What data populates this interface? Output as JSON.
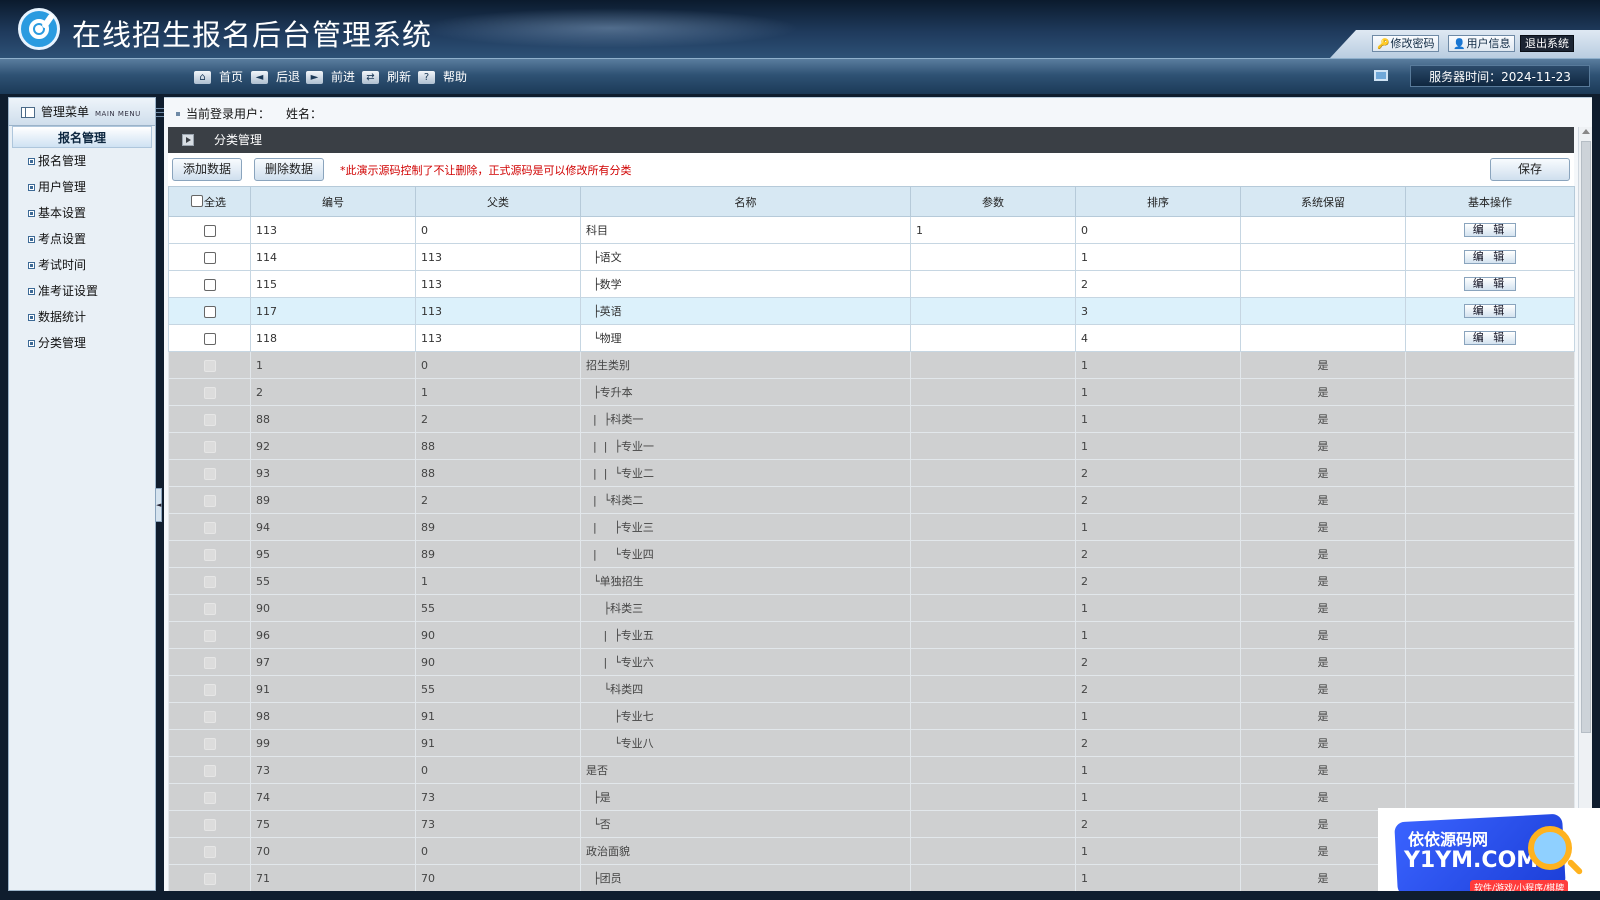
{
  "app": {
    "title": "在线招生报名后台管理系统"
  },
  "top_links": [
    "修改密码",
    "用户信息",
    "退出系统"
  ],
  "nav": [
    "首页",
    "后退",
    "前进",
    "刷新",
    "帮助"
  ],
  "server_time": "服务器时间：2024-11-23",
  "sidebar": {
    "title": "管理菜单",
    "subtitle": "MAIN MENU",
    "group": "报名管理",
    "items": [
      "报名管理",
      "用户管理",
      "基本设置",
      "考点设置",
      "考试时间",
      "准考证设置",
      "数据统计",
      "分类管理"
    ]
  },
  "user_bar": {
    "label": "当前登录用户：",
    "name_label": "姓名："
  },
  "panel_title": "分类管理",
  "toolbar": {
    "add": "添加数据",
    "delete": "删除数据",
    "notice": "*此演示源码控制了不让删除，正式源码是可以修改所有分类",
    "save": "保存"
  },
  "table": {
    "headers": [
      "全选",
      "编号",
      "父类",
      "名称",
      "参数",
      "排序",
      "系统保留",
      "基本操作"
    ],
    "edit_label": "编 辑",
    "rows": [
      {
        "id": "113",
        "parent": "0",
        "name": "科目",
        "param": "1",
        "sort": "0",
        "reserved": "",
        "editable": true
      },
      {
        "id": "114",
        "parent": "113",
        "name": "  ├语文",
        "param": "",
        "sort": "1",
        "reserved": "",
        "editable": true
      },
      {
        "id": "115",
        "parent": "113",
        "name": "  ├数学",
        "param": "",
        "sort": "2",
        "reserved": "",
        "editable": true
      },
      {
        "id": "117",
        "parent": "113",
        "name": "  ├英语",
        "param": "",
        "sort": "3",
        "reserved": "",
        "editable": true,
        "highlight": true
      },
      {
        "id": "118",
        "parent": "113",
        "name": "  └物理",
        "param": "",
        "sort": "4",
        "reserved": "",
        "editable": true
      },
      {
        "id": "1",
        "parent": "0",
        "name": "招生类别",
        "param": "",
        "sort": "1",
        "reserved": "是",
        "editable": false
      },
      {
        "id": "2",
        "parent": "1",
        "name": "  ├专升本",
        "param": "",
        "sort": "1",
        "reserved": "是",
        "editable": false
      },
      {
        "id": "88",
        "parent": "2",
        "name": "  |  ├科类一",
        "param": "",
        "sort": "1",
        "reserved": "是",
        "editable": false
      },
      {
        "id": "92",
        "parent": "88",
        "name": "  |  |  ├专业一",
        "param": "",
        "sort": "1",
        "reserved": "是",
        "editable": false
      },
      {
        "id": "93",
        "parent": "88",
        "name": "  |  |  └专业二",
        "param": "",
        "sort": "2",
        "reserved": "是",
        "editable": false
      },
      {
        "id": "89",
        "parent": "2",
        "name": "  |  └科类二",
        "param": "",
        "sort": "2",
        "reserved": "是",
        "editable": false
      },
      {
        "id": "94",
        "parent": "89",
        "name": "  |     ├专业三",
        "param": "",
        "sort": "1",
        "reserved": "是",
        "editable": false
      },
      {
        "id": "95",
        "parent": "89",
        "name": "  |     └专业四",
        "param": "",
        "sort": "2",
        "reserved": "是",
        "editable": false
      },
      {
        "id": "55",
        "parent": "1",
        "name": "  └单独招生",
        "param": "",
        "sort": "2",
        "reserved": "是",
        "editable": false
      },
      {
        "id": "90",
        "parent": "55",
        "name": "     ├科类三",
        "param": "",
        "sort": "1",
        "reserved": "是",
        "editable": false
      },
      {
        "id": "96",
        "parent": "90",
        "name": "     |  ├专业五",
        "param": "",
        "sort": "1",
        "reserved": "是",
        "editable": false
      },
      {
        "id": "97",
        "parent": "90",
        "name": "     |  └专业六",
        "param": "",
        "sort": "2",
        "reserved": "是",
        "editable": false
      },
      {
        "id": "91",
        "parent": "55",
        "name": "     └科类四",
        "param": "",
        "sort": "2",
        "reserved": "是",
        "editable": false
      },
      {
        "id": "98",
        "parent": "91",
        "name": "        ├专业七",
        "param": "",
        "sort": "1",
        "reserved": "是",
        "editable": false
      },
      {
        "id": "99",
        "parent": "91",
        "name": "        └专业八",
        "param": "",
        "sort": "2",
        "reserved": "是",
        "editable": false
      },
      {
        "id": "73",
        "parent": "0",
        "name": "是否",
        "param": "",
        "sort": "1",
        "reserved": "是",
        "editable": false
      },
      {
        "id": "74",
        "parent": "73",
        "name": "  ├是",
        "param": "",
        "sort": "1",
        "reserved": "是",
        "editable": false
      },
      {
        "id": "75",
        "parent": "73",
        "name": "  └否",
        "param": "",
        "sort": "2",
        "reserved": "是",
        "editable": false
      },
      {
        "id": "70",
        "parent": "0",
        "name": "政治面貌",
        "param": "",
        "sort": "1",
        "reserved": "是",
        "editable": false
      },
      {
        "id": "71",
        "parent": "70",
        "name": "  ├团员",
        "param": "",
        "sort": "1",
        "reserved": "是",
        "editable": false
      }
    ]
  },
  "watermark": {
    "line1": "依依源码网",
    "line2": "Y1YM.COM",
    "line3": "软件/游戏/小程序/棋牌"
  },
  "colors": {
    "header_dark": "#0b1a2d",
    "panel_title": "#3a3f45",
    "reserved_row": "#cfd0d1",
    "highlight_row": "#dcf1fb",
    "notice": "#d00000"
  }
}
